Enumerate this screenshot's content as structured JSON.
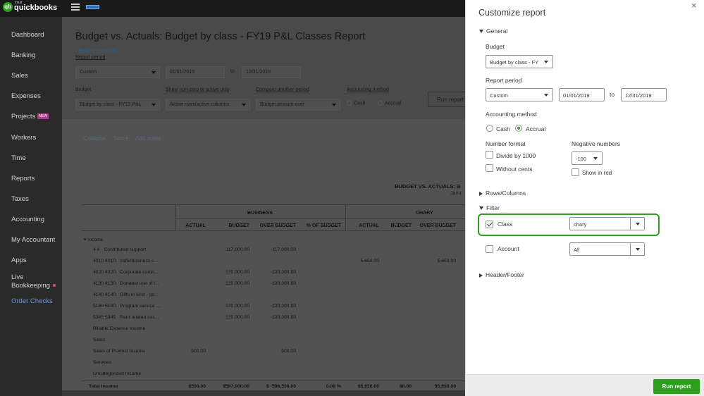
{
  "app": {
    "logo_small": "intuit",
    "logo_name": "quickbooks",
    "logo_badge": "qb"
  },
  "sidebar": {
    "items": [
      "Dashboard",
      "Banking",
      "Sales",
      "Expenses",
      "Projects",
      "Workers",
      "Time",
      "Reports",
      "Taxes",
      "Accounting",
      "My Accountant",
      "Apps"
    ],
    "projects_badge": "NEW",
    "live_line1": "Live",
    "live_line2": "Bookkeeping",
    "order_checks": "Order Checks"
  },
  "report": {
    "title": "Budget vs. Actuals: Budget by class - FY19 P&L Classes Report",
    "back_link": "Back to report list",
    "period_label": "Report period",
    "period_value": "Custom",
    "from_date": "01/01/2019",
    "to_label": "to",
    "to_date": "12/31/2019",
    "budget_label": "Budget",
    "budget_value": "Budget by class - FY19 P&L",
    "nonzero_label": "Show non-zero or active only",
    "nonzero_value": "Active rows/active columns",
    "compare_label": "Compare another period",
    "compare_value": "Budget amount over",
    "method_label": "Accounting method",
    "cash": "Cash",
    "accrual": "Accrual",
    "run_report": "Run report",
    "collapse": "Collapse",
    "sort": "Sort ▾",
    "add_notes": "Add notes",
    "heading": "BUDGET VS. ACTUALS: B",
    "subheading": "Janu",
    "group_business": "BUSINESS",
    "group_chary": "CHARY",
    "columns": [
      "ACTUAL",
      "BUDGET",
      "OVER BUDGET",
      "% OF BUDGET",
      "ACTUAL",
      "BUDGET",
      "OVER BUDGET"
    ],
    "income_label": "▾ Income",
    "rows": [
      {
        "name": "4 4 · Contributed support",
        "vals": [
          "",
          "117,000.00",
          "-117,000.00",
          "",
          "",
          "",
          ""
        ]
      },
      {
        "name": "4010 4010 · Indiv/business c...",
        "vals": [
          "",
          "",
          "",
          "",
          "5,650.00",
          "",
          "5,650.00"
        ]
      },
      {
        "name": "4020 4020 · Corporate contri...",
        "vals": [
          "",
          "120,000.00",
          "-120,000.00",
          "",
          "",
          "",
          ""
        ]
      },
      {
        "name": "4130 4130 · Donated use of f...",
        "vals": [
          "",
          "120,000.00",
          "-120,000.00",
          "",
          "",
          "",
          ""
        ]
      },
      {
        "name": "4140 4140 · Gifts in kind - go...",
        "vals": [
          "",
          "",
          "",
          "",
          "",
          "",
          ""
        ]
      },
      {
        "name": "5180 5180 · Program service ...",
        "vals": [
          "",
          "120,000.00",
          "-120,000.00",
          "",
          "",
          "",
          ""
        ]
      },
      {
        "name": "5345 5345 · Rent related cos...",
        "vals": [
          "",
          "120,000.00",
          "-120,000.00",
          "",
          "",
          "",
          ""
        ]
      },
      {
        "name": "Billable Expense Income",
        "vals": [
          "",
          "",
          "",
          "",
          "",
          "",
          ""
        ]
      },
      {
        "name": "Sales",
        "vals": [
          "",
          "",
          "",
          "",
          "",
          "",
          ""
        ]
      },
      {
        "name": "Sales of Product Income",
        "vals": [
          "500.00",
          "",
          "500.00",
          "",
          "",
          "",
          ""
        ]
      },
      {
        "name": "Services",
        "vals": [
          "",
          "",
          "",
          "",
          "",
          "",
          ""
        ]
      },
      {
        "name": "Uncategorized Income",
        "vals": [
          "",
          "",
          "",
          "",
          "",
          "",
          ""
        ]
      }
    ],
    "total": {
      "name": "Total Income",
      "vals": [
        "$500.00",
        "$597,000.00",
        "$ -596,500.00",
        "0.08 %",
        "$5,650.00",
        "$0.00",
        "$5,650.00"
      ]
    }
  },
  "panel": {
    "title": "Customize report",
    "close": "×",
    "general": "General",
    "budget_label": "Budget",
    "budget_value": "Budget by class - FY",
    "period_label": "Report period",
    "period_value": "Custom",
    "from_date": "01/01/2019",
    "to_label": "to",
    "to_date": "12/31/2019",
    "method_label": "Accounting method",
    "cash": "Cash",
    "accrual": "Accrual",
    "number_format": "Number format",
    "divide": "Divide by 1000",
    "without_cents": "Without cents",
    "negative_label": "Negative numbers",
    "negative_value": "-100",
    "show_red": "Show in red",
    "rows_columns": "Rows/Columns",
    "filter": "Filter",
    "class_label": "Class",
    "class_value": "chary",
    "account_label": "Account",
    "account_value": "All",
    "header_footer": "Header/Footer",
    "run_report": "Run report"
  }
}
